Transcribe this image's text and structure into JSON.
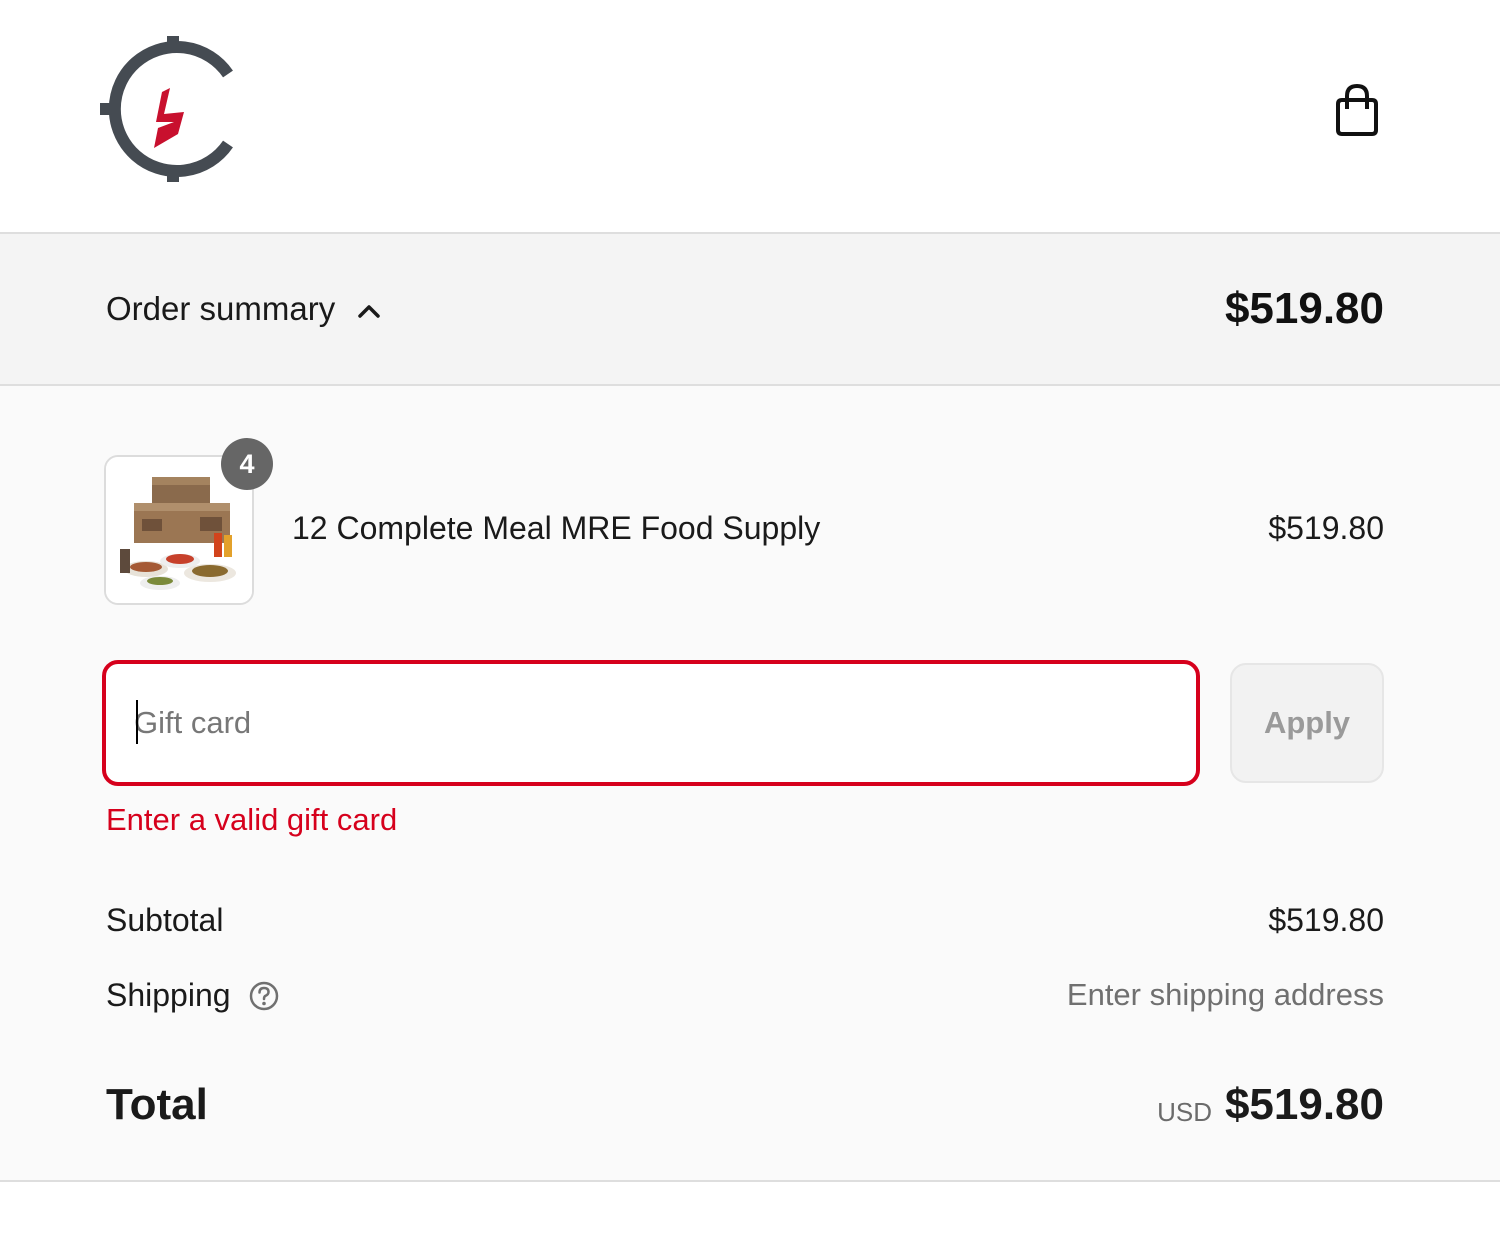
{
  "header": {
    "logo": "brand-logo",
    "cart_icon": "shopping-bag-icon"
  },
  "summary": {
    "label": "Order summary",
    "toggle_icon": "chevron-up-icon",
    "total": "$519.80"
  },
  "items": [
    {
      "name": "12 Complete Meal MRE Food Supply",
      "quantity": "4",
      "price": "$519.80"
    }
  ],
  "gift_card": {
    "placeholder": "Gift card",
    "value": "",
    "apply_label": "Apply",
    "error": "Enter a valid gift card"
  },
  "totals": {
    "subtotal_label": "Subtotal",
    "subtotal_value": "$519.80",
    "shipping_label": "Shipping",
    "shipping_value": "Enter shipping address",
    "total_label": "Total",
    "currency": "USD",
    "total_value": "$519.80"
  },
  "colors": {
    "error": "#d6001c",
    "brand_red": "#c8102e",
    "brand_gray": "#454b52"
  }
}
